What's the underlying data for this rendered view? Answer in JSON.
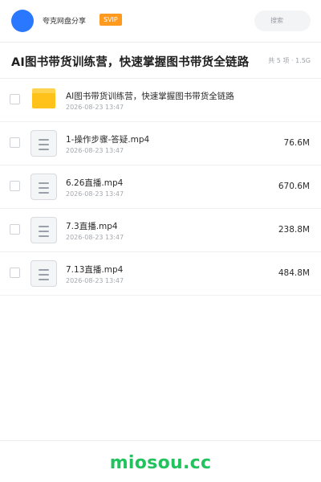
{
  "header": {
    "username": "夸克网盘分享",
    "badge": "SVIP",
    "search_placeholder": "搜索",
    "avatar_color": "#2a78ff",
    "badge_color": "#ff9a1f"
  },
  "folder": {
    "title": "AI图书带货训练营，快速掌握图书带货全链路",
    "summary": "共 5 项 · 1.5G"
  },
  "files": [
    {
      "name": "AI图书带货训练营，快速掌握图书带货全链路",
      "date": "2026-08-23 13:47",
      "size": "",
      "icon": "folder-icon"
    },
    {
      "name": "1-操作步骤-答疑.mp4",
      "date": "2026-08-23 13:47",
      "size": "76.6M",
      "icon": "video-file-icon"
    },
    {
      "name": "6.26直播.mp4",
      "date": "2026-08-23 13:47",
      "size": "670.6M",
      "icon": "video-file-icon"
    },
    {
      "name": "7.3直播.mp4",
      "date": "2026-08-23 13:47",
      "size": "238.8M",
      "icon": "video-file-icon"
    },
    {
      "name": "7.13直播.mp4",
      "date": "2026-08-23 13:47",
      "size": "484.8M",
      "icon": "video-file-icon"
    }
  ],
  "footer": {
    "watermark": "miosou.cc",
    "watermark_color": "#22c35e"
  }
}
